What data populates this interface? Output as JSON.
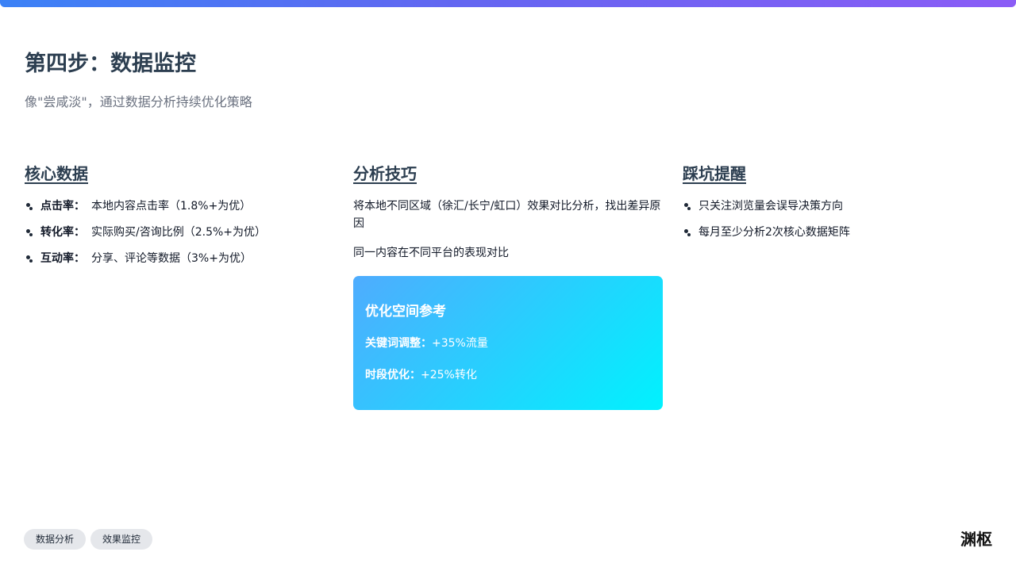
{
  "header": {
    "title": "第四步：数据监控",
    "subtitle": "像\"尝咸淡\"，通过数据分析持续优化策略"
  },
  "columns": {
    "core_data": {
      "heading": "核心数据",
      "items": [
        {
          "label": "点击率：",
          "text": "本地内容点击率（1.8%+为优）"
        },
        {
          "label": "转化率：",
          "text": "实际购买/咨询比例（2.5%+为优）"
        },
        {
          "label": "互动率：",
          "text": "分享、评论等数据（3%+为优）"
        }
      ]
    },
    "analysis": {
      "heading": "分析技巧",
      "paragraphs": [
        "将本地不同区域（徐汇/长宁/虹口）效果对比分析，找出差异原因",
        "同一内容在不同平台的表现对比"
      ],
      "card": {
        "title": "优化空间参考",
        "lines": [
          {
            "label": "关键词调整：",
            "value": "+35%流量"
          },
          {
            "label": "时段优化：",
            "value": "+25%转化"
          }
        ],
        "gradient_start": "#4facfe",
        "gradient_end": "#00f2fe"
      }
    },
    "pitfalls": {
      "heading": "踩坑提醒",
      "items": [
        "只关注浏览量会误导决策方向",
        "每月至少分析2次核心数据矩阵"
      ]
    }
  },
  "footer": {
    "tags": [
      "数据分析",
      "效果监控"
    ],
    "brand": "渊枢"
  },
  "colors": {
    "title": "#2c3e50",
    "subtitle": "#6b7280",
    "top_bar_start": "#3b82f6",
    "top_bar_end": "#8b5cf6"
  }
}
